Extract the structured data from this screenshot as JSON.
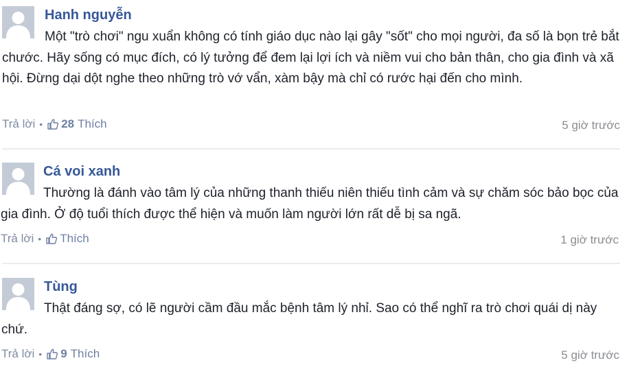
{
  "comments": [
    {
      "author": "Hanh nguyễn",
      "text": "Một \"trò chơi\" ngu xuẩn không có tính giáo dục nào lại gây \"sốt\" cho mọi người, đa số là bọn trẻ bắt chước. Hãy sống có mục đích, có lý tưởng để đem lại lợi ích và niềm vui cho bản thân, cho gia đình và xã hội. Đừng dại dột nghe theo những trò vớ vẩn, xàm bậy mà chỉ có rước hại đến cho mình.",
      "reply_label": "Trả lời",
      "separator": "•",
      "like_count": "28",
      "like_label": "Thích",
      "time": "5 giờ trước"
    },
    {
      "author": "Cá voi xanh",
      "text": "Thường là đánh vào tâm lý của những thanh thiếu niên thiếu tình cảm và sự chăm sóc bảo bọc của gia đình. Ở độ tuổi thích được thể hiện và muốn làm người lớn rất dễ bị sa ngã.",
      "reply_label": "Trả lời",
      "separator": "•",
      "like_count": "",
      "like_label": "Thích",
      "time": "1 giờ trước"
    },
    {
      "author": "Tùng",
      "text": "Thật đáng sợ, có lẽ người cầm đầu mắc bệnh tâm lý nhỉ. Sao có thể nghĩ ra trò chơi quái dị này chứ.",
      "reply_label": "Trả lời",
      "separator": "•",
      "like_count": "9",
      "like_label": "Thích",
      "time": "5 giờ trước"
    }
  ],
  "colors": {
    "author": "#365899",
    "body": "#1d2129",
    "meta": "#7f8ba3",
    "avatar_bg": "#c3cbd6",
    "divider": "#e9ebee"
  },
  "icons": {
    "avatar": "default-user-silhouette-icon",
    "like": "thumbs-up-icon"
  }
}
